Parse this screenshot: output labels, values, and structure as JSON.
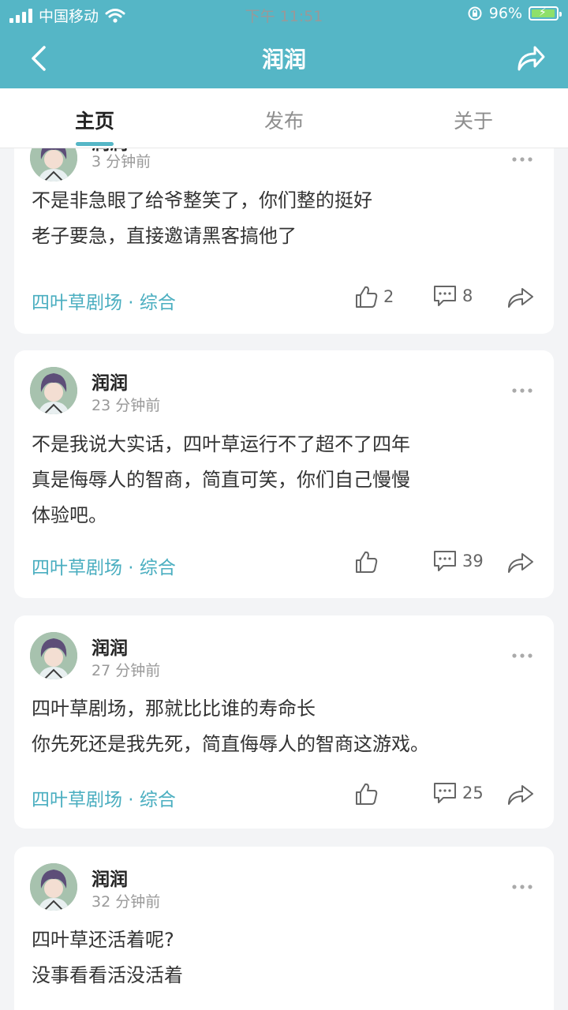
{
  "status_bar": {
    "carrier": "中国移动",
    "time": "下午 11:51",
    "battery": "96%",
    "battery_level": 0.96
  },
  "header": {
    "title": "润润"
  },
  "tabs": [
    {
      "label": "主页",
      "active": true
    },
    {
      "label": "发布",
      "active": false
    },
    {
      "label": "关于",
      "active": false
    }
  ],
  "posts": [
    {
      "username": "润润",
      "time": "3 分钟前",
      "lines": [
        "不是非急眼了给爷整笑了，你们整的挺好",
        "老子要急，直接邀请黑客搞他了"
      ],
      "tag": "四叶草剧场 · 综合",
      "likes": "2",
      "comments": "8"
    },
    {
      "username": "润润",
      "time": "23 分钟前",
      "lines": [
        "不是我说大实话，四叶草运行不了超不了四年",
        "真是侮辱人的智商，简直可笑，你们自己慢慢",
        "体验吧。"
      ],
      "tag": "四叶草剧场 · 综合",
      "likes": "",
      "comments": "39"
    },
    {
      "username": "润润",
      "time": "27 分钟前",
      "lines": [
        "四叶草剧场，那就比比谁的寿命长",
        "你先死还是我先死，简直侮辱人的智商这游戏。"
      ],
      "tag": "四叶草剧场 · 综合",
      "likes": "",
      "comments": "25"
    },
    {
      "username": "润润",
      "time": "32 分钟前",
      "lines": [
        "四叶草还活着呢?",
        "没事看看活没活着"
      ],
      "tag": "",
      "likes": "",
      "comments": ""
    }
  ],
  "colors": {
    "accent": "#55b6c6",
    "tag": "#4aaec0"
  }
}
